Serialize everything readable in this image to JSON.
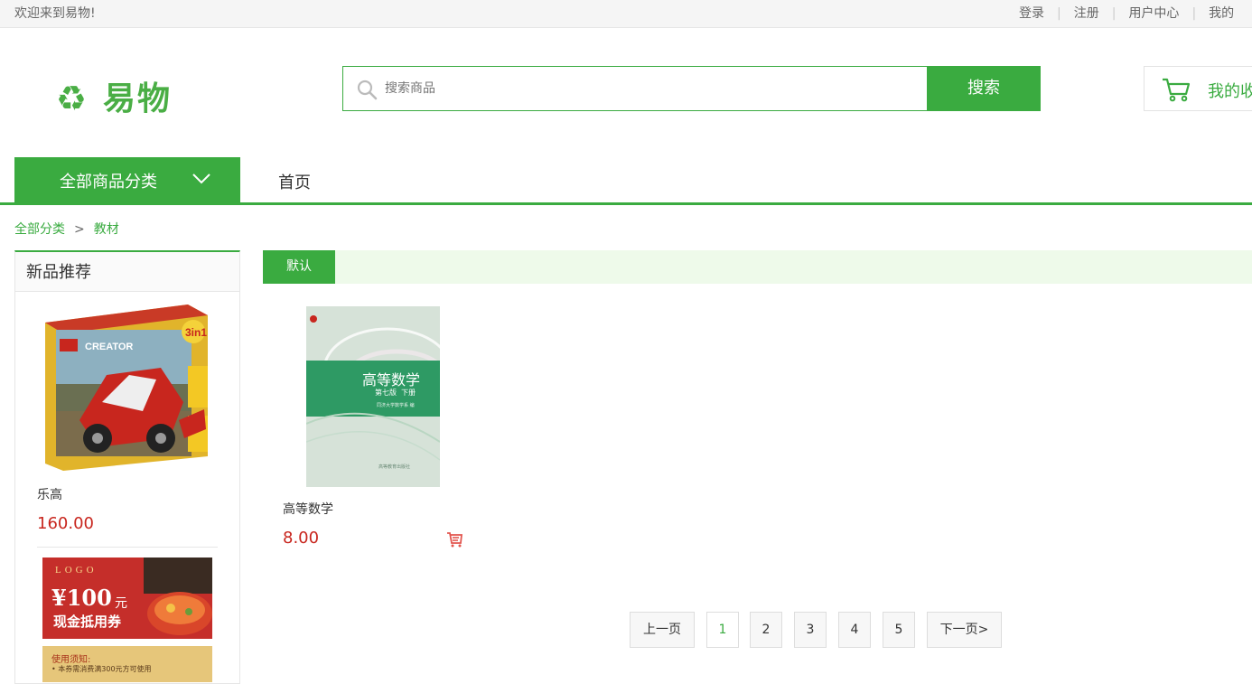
{
  "topbar": {
    "welcome": "欢迎来到易物!",
    "links": [
      "登录",
      "注册",
      "用户中心",
      "我的"
    ]
  },
  "logo": {
    "text": "易物"
  },
  "search": {
    "placeholder": "搜索商品",
    "button": "搜索"
  },
  "cart": {
    "label": "我的收"
  },
  "nav": {
    "all_categories": "全部商品分类",
    "home": "首页"
  },
  "breadcrumb": {
    "root": "全部分类",
    "sep": ">",
    "current": "教材"
  },
  "sidebar": {
    "title": "新品推荐",
    "items": [
      {
        "name": "乐高",
        "price": "160.00"
      }
    ],
    "coupon": {
      "logo": "LOGO",
      "amount": "¥100",
      "unit": "元",
      "text": "现金抵用券",
      "notice": "使用须知:",
      "rule": "• 本券需消费满300元方可使用"
    }
  },
  "sort": {
    "default": "默认"
  },
  "products": [
    {
      "name": "高等数学",
      "price": "8.00",
      "cover_title": "高等数学",
      "cover_edition": "第七版  下册",
      "cover_author": "同济大学数学系 编",
      "cover_publisher": "高等教育出版社"
    }
  ],
  "pager": {
    "prev": "上一页",
    "pages": [
      "1",
      "2",
      "3",
      "4",
      "5"
    ],
    "next": "下一页>",
    "current": "1"
  },
  "colors": {
    "accent": "#3aab40",
    "price": "#c8261e"
  },
  "icons": [
    "recycle-icon",
    "search-icon",
    "cart-icon",
    "chevron-down-icon",
    "add-to-cart-icon"
  ]
}
